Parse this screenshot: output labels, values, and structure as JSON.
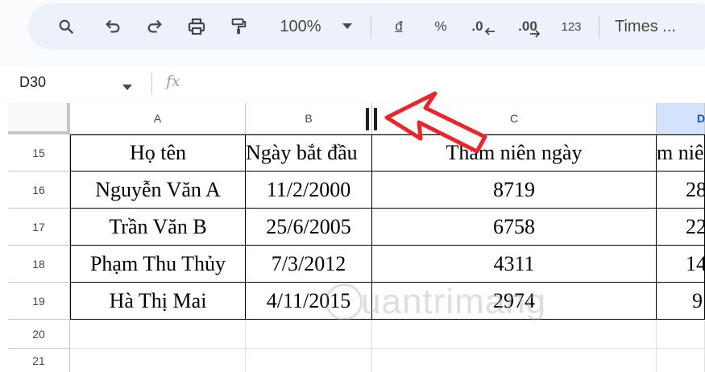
{
  "toolbar": {
    "zoom": "100%",
    "currency": "đ",
    "percent": "%",
    "decrease_decimal": ".0",
    "increase_decimal": ".00",
    "number_format": "123",
    "font": "Times ..."
  },
  "formula_bar": {
    "name_box": "D30",
    "fx": "fx",
    "value": ""
  },
  "columns": [
    "A",
    "B",
    "C",
    "D"
  ],
  "rows": [
    {
      "num": "15",
      "cells": [
        "Họ tên",
        "Ngày bắt đầu",
        "Thâm niên ngày",
        "m niê"
      ]
    },
    {
      "num": "16",
      "cells": [
        "Nguyễn Văn A",
        "11/2/2000",
        "8719",
        "28"
      ]
    },
    {
      "num": "17",
      "cells": [
        "Trần Văn B",
        "25/6/2005",
        "6758",
        "22"
      ]
    },
    {
      "num": "18",
      "cells": [
        "Phạm Thu Thủy",
        "7/3/2012",
        "4311",
        "14"
      ]
    },
    {
      "num": "19",
      "cells": [
        "Hà Thị Mai",
        "4/11/2015",
        "2974",
        "9"
      ]
    },
    {
      "num": "20",
      "cells": [
        "",
        "",
        "",
        ""
      ]
    },
    {
      "num": "21",
      "cells": [
        "",
        "",
        "",
        ""
      ]
    }
  ],
  "watermark": "uantrimang",
  "colors": {
    "accent": "#0b57d0",
    "selected_header": "#d3e3fd",
    "arrow": "#e8262e"
  }
}
